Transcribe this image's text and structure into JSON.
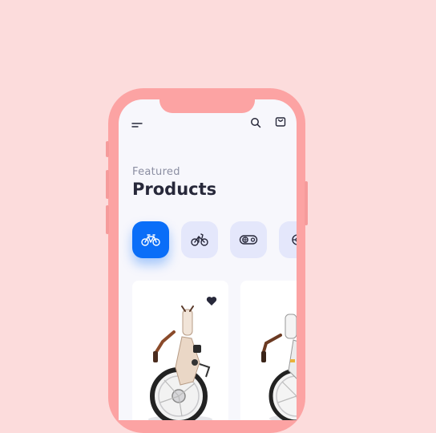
{
  "header": {
    "menu_icon": "menu-icon",
    "search_icon": "search-icon",
    "cart_icon": "cart-icon"
  },
  "section": {
    "eyebrow": "Featured",
    "title": "Products"
  },
  "categories": [
    {
      "icon": "bike-icon",
      "selected": true
    },
    {
      "icon": "bike-icon",
      "selected": false
    },
    {
      "icon": "chain-ring-icon",
      "selected": false
    },
    {
      "icon": "gear-icon",
      "selected": false
    }
  ],
  "products": [
    {
      "image": "folding-ebike-image",
      "favorite": true
    },
    {
      "image": "folding-ebike-image",
      "favorite": false
    }
  ],
  "colors": {
    "background": "#fcdcdc",
    "phone": "#fca3a3",
    "accent": "#0a6ef8",
    "category_bg": "#e4e7fb",
    "title": "#27283a"
  }
}
